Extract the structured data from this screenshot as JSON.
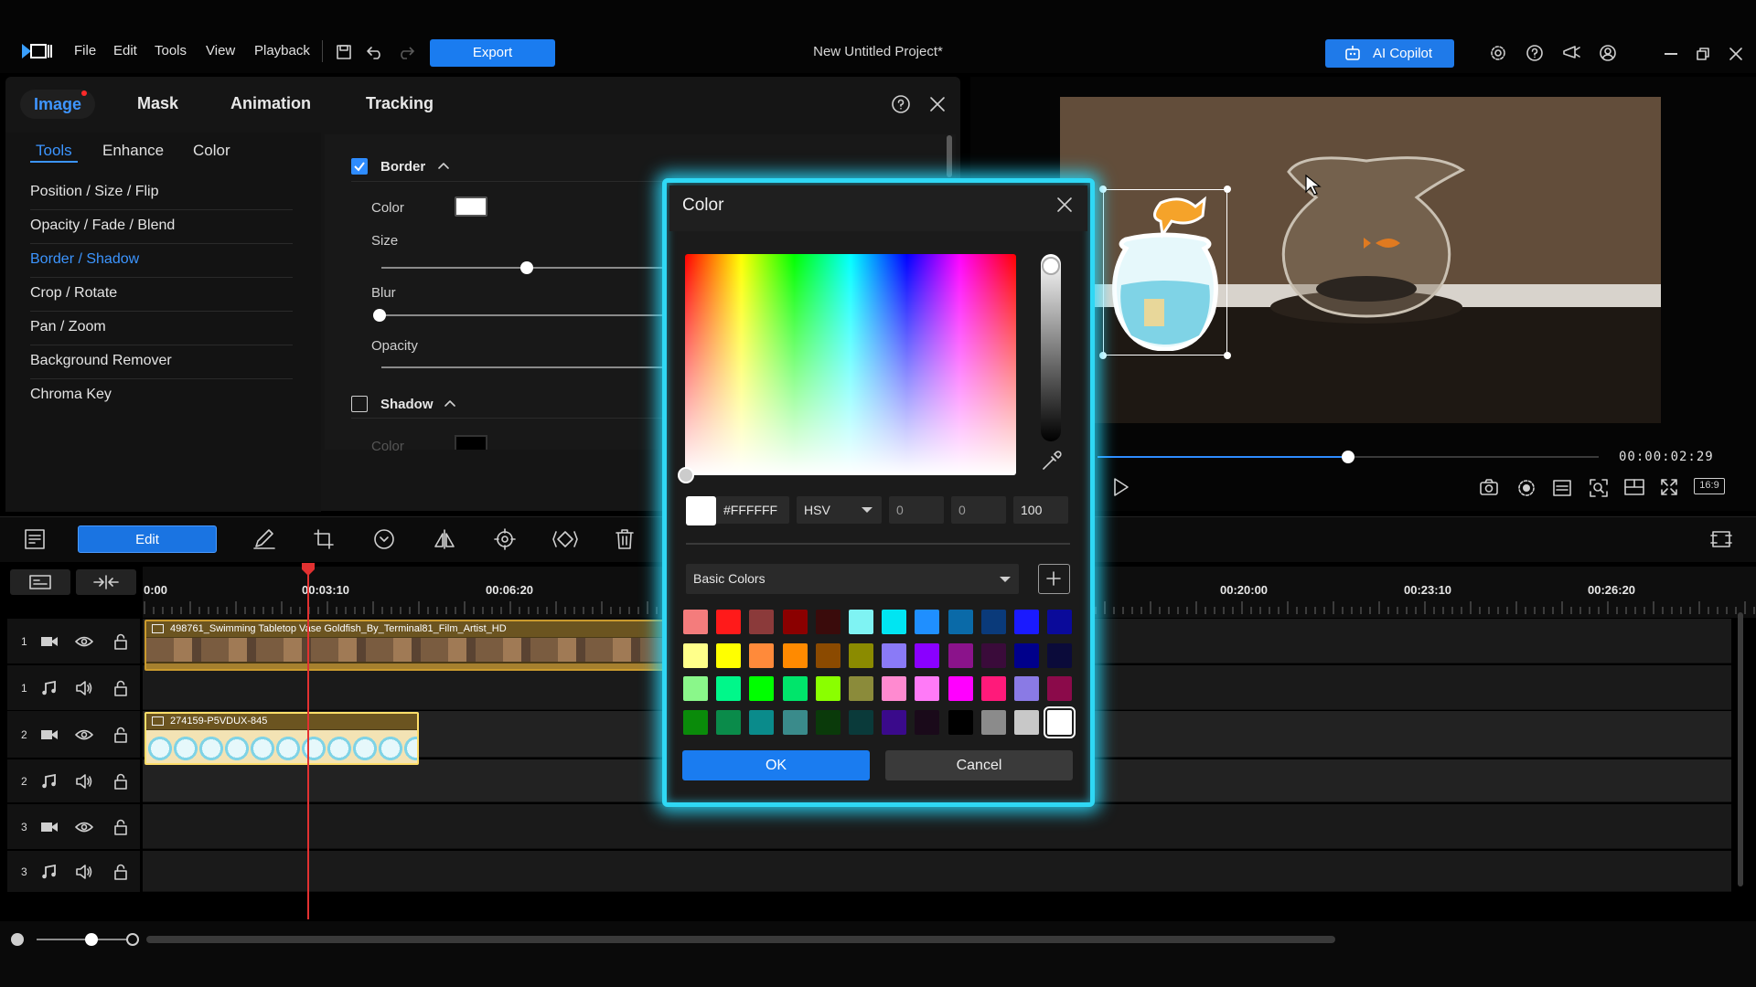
{
  "menu": {
    "file": "File",
    "edit": "Edit",
    "tools": "Tools",
    "view": "View",
    "playback": "Playback",
    "export_label": "Export",
    "project_title": "New Untitled Project*",
    "copilot_label": "AI Copilot"
  },
  "props": {
    "tabs": [
      "Image",
      "Mask",
      "Animation",
      "Tracking"
    ],
    "sub_tabs": [
      "Tools",
      "Enhance",
      "Color"
    ],
    "side_items": [
      "Position / Size / Flip",
      "Opacity / Fade / Blend",
      "Border / Shadow",
      "Crop / Rotate",
      "Pan / Zoom",
      "Background Remover",
      "Chroma Key"
    ],
    "active_side_item": "Border / Shadow",
    "border_label": "Border",
    "border_checked": true,
    "color_label": "Color",
    "size_label": "Size",
    "size_value": 0.52,
    "blur_label": "Blur",
    "blur_value": 0.0,
    "opacity_label": "Opacity",
    "shadow_label": "Shadow",
    "shadow_checked": false,
    "shadow_color_label": "Color"
  },
  "preview": {
    "timecode": "00:00:02:29",
    "aspect_label": "16:9",
    "playback_position": 0.5
  },
  "timeline": {
    "edit_label": "Edit",
    "ruler_labels": [
      "0:00",
      "00:03:10",
      "00:06:20",
      "00:20:00",
      "00:23:10",
      "00:26:20"
    ],
    "tracks": [
      {
        "num": "1",
        "kind": "video"
      },
      {
        "num": "1",
        "kind": "audio"
      },
      {
        "num": "2",
        "kind": "video"
      },
      {
        "num": "2",
        "kind": "audio"
      },
      {
        "num": "3",
        "kind": "video"
      },
      {
        "num": "3",
        "kind": "audio"
      }
    ],
    "clip1_title": "498761_Swimming Tabletop Vase Goldfish_By_Terminal81_Film_Artist_HD",
    "clip2_title": "274159-P5VDUX-845"
  },
  "color_dialog": {
    "title": "Color",
    "hex_value": "#FFFFFF",
    "mode": "HSV",
    "h": "0",
    "s": "0",
    "v": "100",
    "palette_label": "Basic Colors",
    "ok_label": "OK",
    "cancel_label": "Cancel",
    "swatches": [
      [
        "#f47c7c",
        "#ff1a1a",
        "#8b3a3a",
        "#8b0000",
        "#3a0b0b",
        "#7ff3f3",
        "#00e5f2",
        "#1f8fff",
        "#0a6aa8",
        "#0a3a7a",
        "#1a1aff",
        "#0a0a9a"
      ],
      [
        "#ffff8a",
        "#ffff00",
        "#ff8a3a",
        "#ff8a00",
        "#8b4a00",
        "#8b8b00",
        "#8a7af7",
        "#8a00ff",
        "#8b138b",
        "#3a0b3a",
        "#00008b",
        "#0b0b3a"
      ],
      [
        "#8af78a",
        "#00f78a",
        "#00ff00",
        "#00e56b",
        "#8aff00",
        "#8b8b3a",
        "#ff8ad0",
        "#ff7af7",
        "#ff00ff",
        "#ff1a7a",
        "#8a7ae5",
        "#8b0a4a"
      ],
      [
        "#0a8b0a",
        "#0a8b4a",
        "#0a8b8b",
        "#3a8b8b",
        "#0a3a0a",
        "#0a3a3a",
        "#3a0a8b",
        "#1a0a1a",
        "#000000",
        "#8b8b8b",
        "#c8c8c8",
        "#ffffff"
      ]
    ]
  }
}
